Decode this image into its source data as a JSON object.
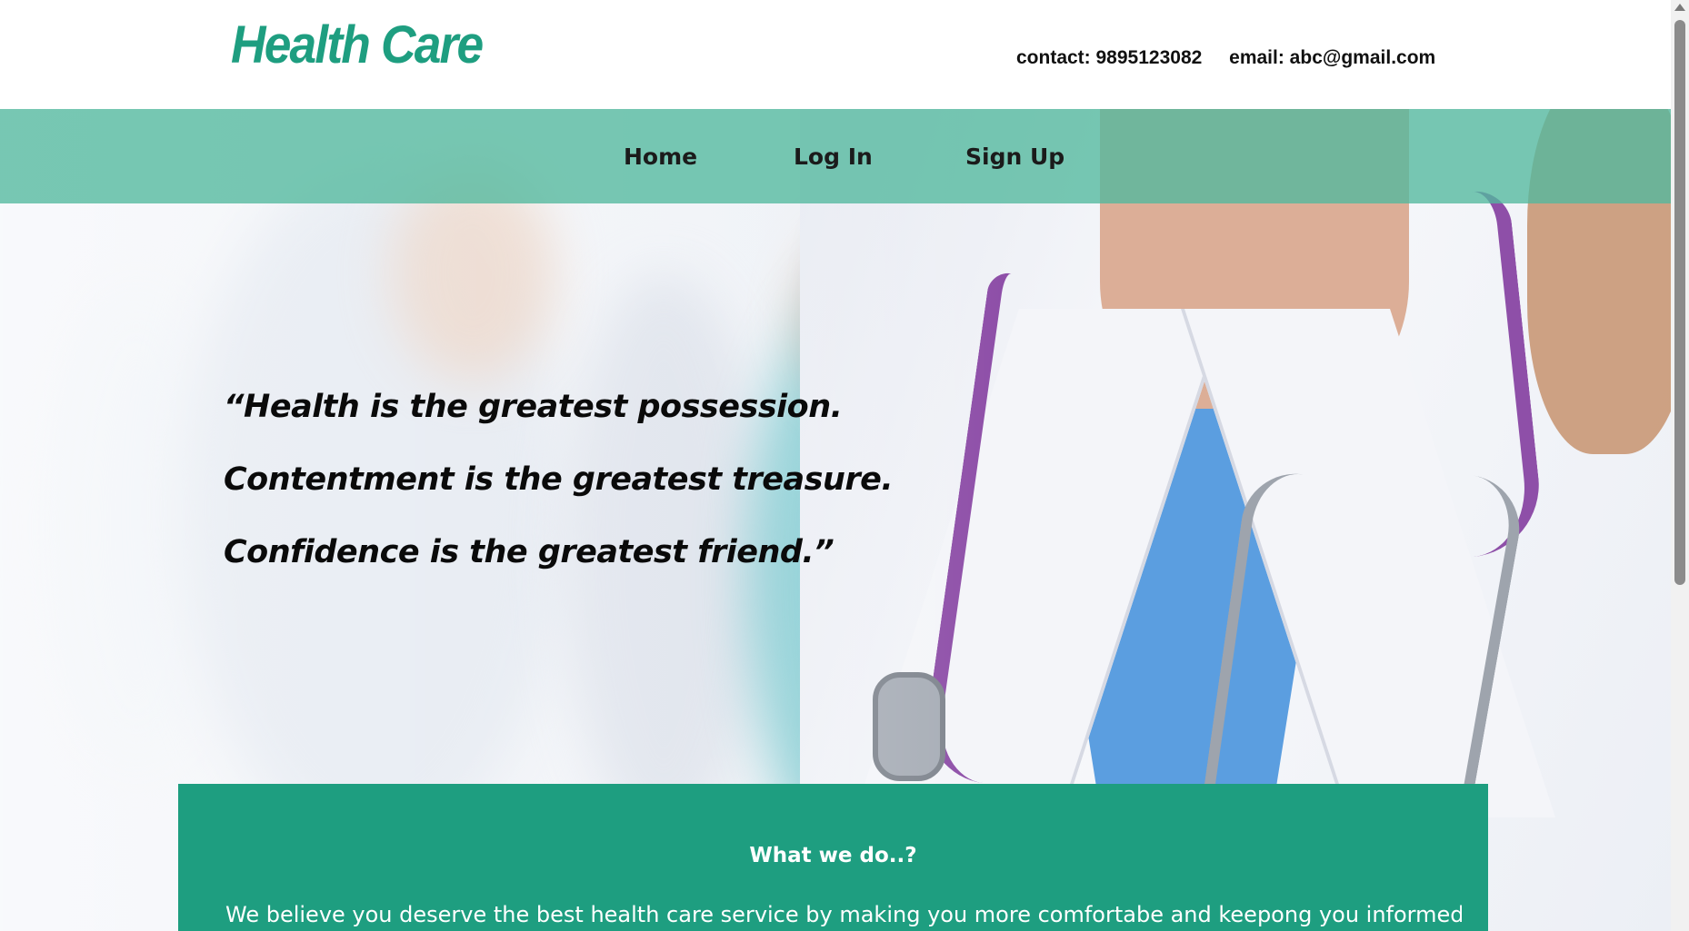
{
  "header": {
    "logo": "Health Care",
    "contact": "contact: 9895123082",
    "email": "email: abc@gmail.com"
  },
  "nav": {
    "items": [
      {
        "label": "Home"
      },
      {
        "label": "Log In"
      },
      {
        "label": "Sign Up"
      }
    ]
  },
  "hero": {
    "quote_lines": [
      "“Health is the greatest possession.",
      "Contentment is the greatest treasure.",
      "Confidence is the greatest friend.”"
    ]
  },
  "about": {
    "heading": "What we do..?",
    "text": "We believe you deserve the best health care service by making you more comfortabe and keepong you informed on your"
  },
  "colors": {
    "brand": "#1e9e80",
    "nav_bg": "#52b89e"
  }
}
